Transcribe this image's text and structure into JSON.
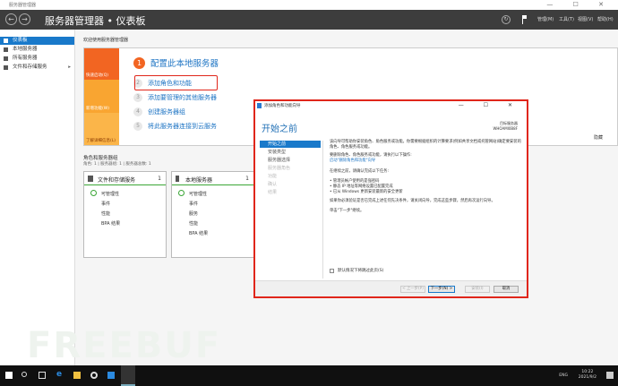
{
  "window": {
    "title": "服务器管理器",
    "controls": "— ☐ ✕"
  },
  "header": {
    "title": "服务器管理器 • 仪表板",
    "menus": [
      "管理(M)",
      "工具(T)",
      "视图(V)",
      "帮助(H)"
    ]
  },
  "sidebar": {
    "items": [
      {
        "label": "仪表板"
      },
      {
        "label": "本地服务器"
      },
      {
        "label": "所有服务器"
      },
      {
        "label": "文件和存储服务"
      }
    ]
  },
  "main": {
    "welcome": "欢迎使用服务器管理器",
    "quickstart": {
      "tabs": [
        "快速启动(Q)",
        "新增功能(W)",
        "了解详细信息(L)"
      ],
      "steps": [
        {
          "n": "1",
          "label": "配置此本地服务器"
        },
        {
          "n": "2",
          "label": "添加角色和功能"
        },
        {
          "n": "3",
          "label": "添加要管理的其他服务器"
        },
        {
          "n": "4",
          "label": "创建服务器组"
        },
        {
          "n": "5",
          "label": "将此服务器连接到云服务"
        }
      ],
      "hide": "隐藏"
    },
    "roles_title": "角色和服务器组",
    "roles_sub": "角色: 1 | 服务器组: 1 | 服务器总数: 1",
    "tiles": [
      {
        "name": "文件和存储服务",
        "count": "1",
        "rows": [
          "可管理性",
          "事件",
          "性能",
          "BPA 结果"
        ]
      },
      {
        "name": "本地服务器",
        "count": "1",
        "rows": [
          "可管理性",
          "事件",
          "服务",
          "性能",
          "BPA 结果"
        ]
      }
    ]
  },
  "dialog": {
    "title": "添加角色和功能向导",
    "heading": "开始之前",
    "target_label": "目标服务器",
    "target_name": "WHOAMI0B8F",
    "nav": [
      "开始之前",
      "安装类型",
      "服务器选择",
      "服务器角色",
      "功能",
      "确认",
      "结果"
    ],
    "p1": "该向导可帮助你安装角色、角色服务或功能。你需要根据组织的计算要求(例如共享文档或托管网站)确定要安装的角色、角色服务或功能。",
    "p2": "要删除角色、角色服务或功能，请执行以下操作:",
    "link": "启动\"删除角色和功能\"向导",
    "p3": "在继续之前，请确认完成以下任务:",
    "bullets": [
      "• 管理员帐户使用的是强密码",
      "• 静态 IP 地址等网络设置已配置完成",
      "• 已从 Windows 更新安装最新的安全更新"
    ],
    "p4": "如果你必须验证是否已完成上述任何先决条件，请关闭向导，完成这些步骤，然后再次运行向导。",
    "p5": "单击\"下一步\"继续。",
    "skip": "默认情况下将跳过此页(S)",
    "buttons": {
      "prev": "< 上一步(P)",
      "next": "下一步(N) >",
      "install": "安装(I)",
      "cancel": "取消"
    }
  },
  "watermark": "FREEBUF",
  "taskbar": {
    "tray": "ENG",
    "time": "10:22",
    "date": "2021/9/2"
  }
}
